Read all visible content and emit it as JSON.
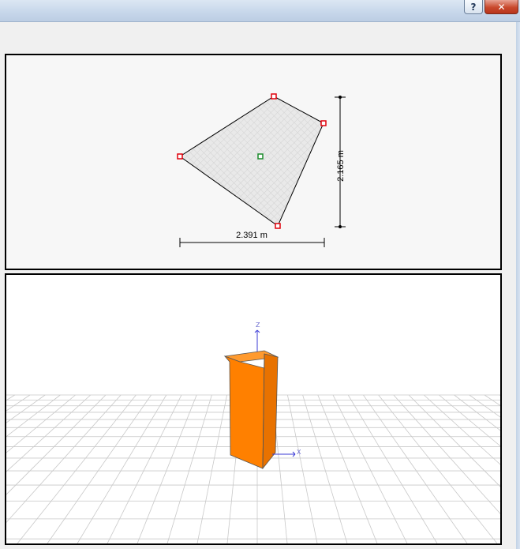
{
  "window": {
    "help_button": "?",
    "close_button": "✕"
  },
  "plan_view": {
    "width_dimension": "2.391 m",
    "height_dimension": "2.165 m",
    "vertex_color": "#e0000b",
    "center_color": "#1a8a2a",
    "fill_color": "#e6e6e6"
  },
  "view_3d": {
    "z_axis_label": "Z",
    "x_axis_label": "X",
    "object_color": "#ff8000",
    "axis_color": "#3b3bd6",
    "grid_color": "#c8c8c8"
  }
}
